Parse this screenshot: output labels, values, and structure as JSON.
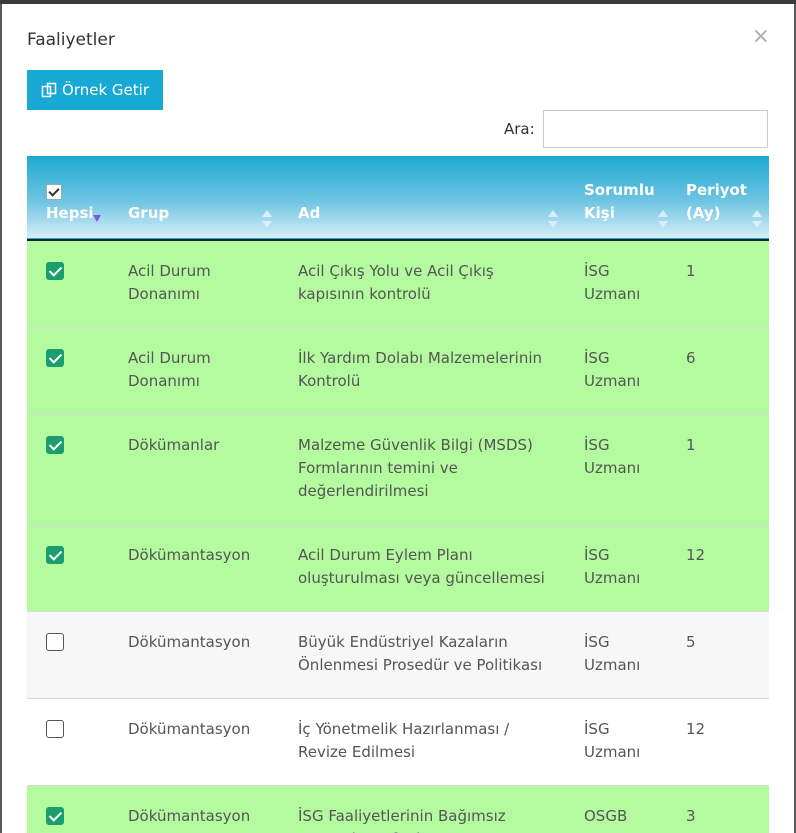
{
  "modal": {
    "title": "Faaliyetler",
    "close_symbol": "×",
    "example_button_label": "Örnek Getir",
    "search_label": "Ara:",
    "search_value": ""
  },
  "table": {
    "columns": [
      "Hepsi",
      "Grup",
      "Ad",
      "Sorumlu Kişi",
      "Periyot (Ay)"
    ],
    "rows": [
      {
        "checked": true,
        "grup": "Acil Durum Donanımı",
        "ad": "Acil Çıkış Yolu ve Acil Çıkış kapısının kontrolü",
        "sorumlu": "İSG Uzmanı",
        "periyot": "1"
      },
      {
        "checked": true,
        "grup": "Acil Durum Donanımı",
        "ad": "İlk Yardım Dolabı Malzemelerinin Kontrolü",
        "sorumlu": "İSG Uzmanı",
        "periyot": "6"
      },
      {
        "checked": true,
        "grup": "Dökümanlar",
        "ad": "Malzeme Güvenlik Bilgi (MSDS) Formlarının temini ve değerlendirilmesi",
        "sorumlu": "İSG Uzmanı",
        "periyot": "1"
      },
      {
        "checked": true,
        "grup": "Dökümantasyon",
        "ad": "Acil Durum Eylem Planı oluşturulması veya güncellemesi",
        "sorumlu": "İSG Uzmanı",
        "periyot": "12"
      },
      {
        "checked": false,
        "grup": "Dökümantasyon",
        "ad": "Büyük Endüstriyel Kazaların Önlenmesi Prosedür ve Politikası",
        "sorumlu": "İSG Uzmanı",
        "periyot": "5"
      },
      {
        "checked": false,
        "grup": "Dökümantasyon",
        "ad": "İç Yönetmelik Hazırlanması / Revize Edilmesi",
        "sorumlu": "İSG Uzmanı",
        "periyot": "12"
      },
      {
        "checked": true,
        "grup": "Dökümantasyon",
        "ad": "İSG Faaliyetlerinin Bağımsız Denetçi Tarafından Sına...",
        "sorumlu": "OSGB",
        "periyot": "3"
      }
    ]
  },
  "colors": {
    "accent": "#17a9d4",
    "checked_row": "#b3fb9e",
    "checkbox_on": "#1b9e6e"
  },
  "icons": {
    "button": "copy-icon",
    "close": "close-icon",
    "sort": "sort-icon"
  }
}
